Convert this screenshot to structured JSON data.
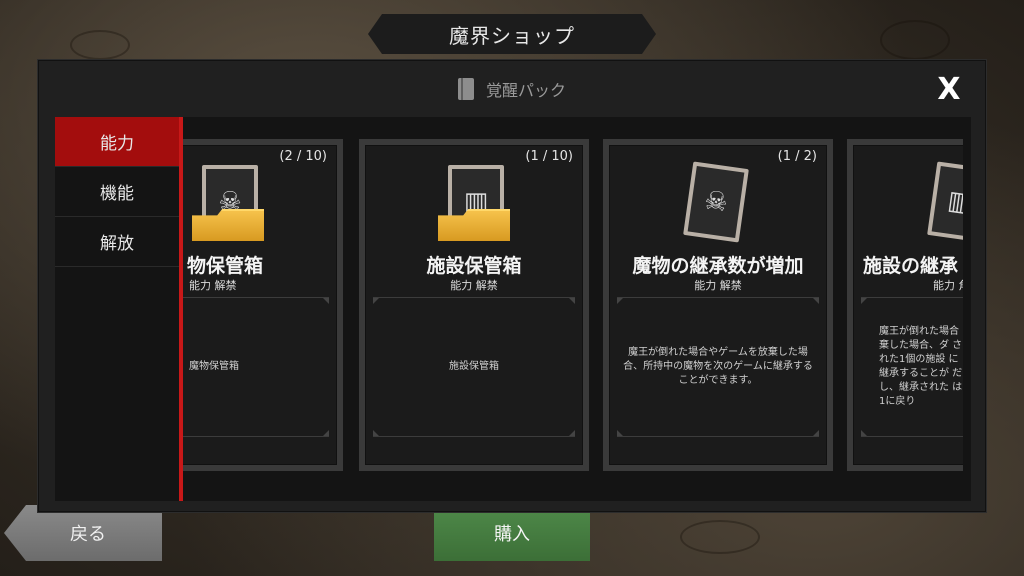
{
  "shop_title": "魔界ショップ",
  "dialog": {
    "header": "覚醒パック",
    "close_label": "X"
  },
  "sidebar": {
    "tabs": [
      {
        "label": "能力",
        "active": true
      },
      {
        "label": "機能",
        "active": false
      },
      {
        "label": "解放",
        "active": false
      }
    ]
  },
  "cards": [
    {
      "count": "(2 / 10)",
      "name": "物保管箱",
      "subtitle": "能力 解禁",
      "description": "魔物保管箱",
      "icon": "monster-card-with-folder"
    },
    {
      "count": "(1 / 10)",
      "name": "施設保管箱",
      "subtitle": "能力 解禁",
      "description": "施設保管箱",
      "icon": "facility-card-with-folder"
    },
    {
      "count": "(1 / 2)",
      "name": "魔物の継承数が増加",
      "subtitle": "能力 解禁",
      "description": "魔王が倒れた場合やゲームを放棄した場合、所持中の魔物を次のゲームに継承することができます。",
      "icon": "monster-card"
    },
    {
      "count": "",
      "name": "施設の継承",
      "subtitle": "能力 角",
      "description": "魔王が倒れた場合 棄した場合、ダ された1個の施設 に継承することが だし、継承された は1に戻り",
      "icon": "facility-card"
    }
  ],
  "buttons": {
    "back": "戻る",
    "buy": "購入"
  },
  "colors": {
    "active_tab": "#a30d0d",
    "accent_rule": "#c81818",
    "buy_button": "#4f8a4a",
    "back_button": "#7a7a7a",
    "folder": "#f0b43a"
  }
}
